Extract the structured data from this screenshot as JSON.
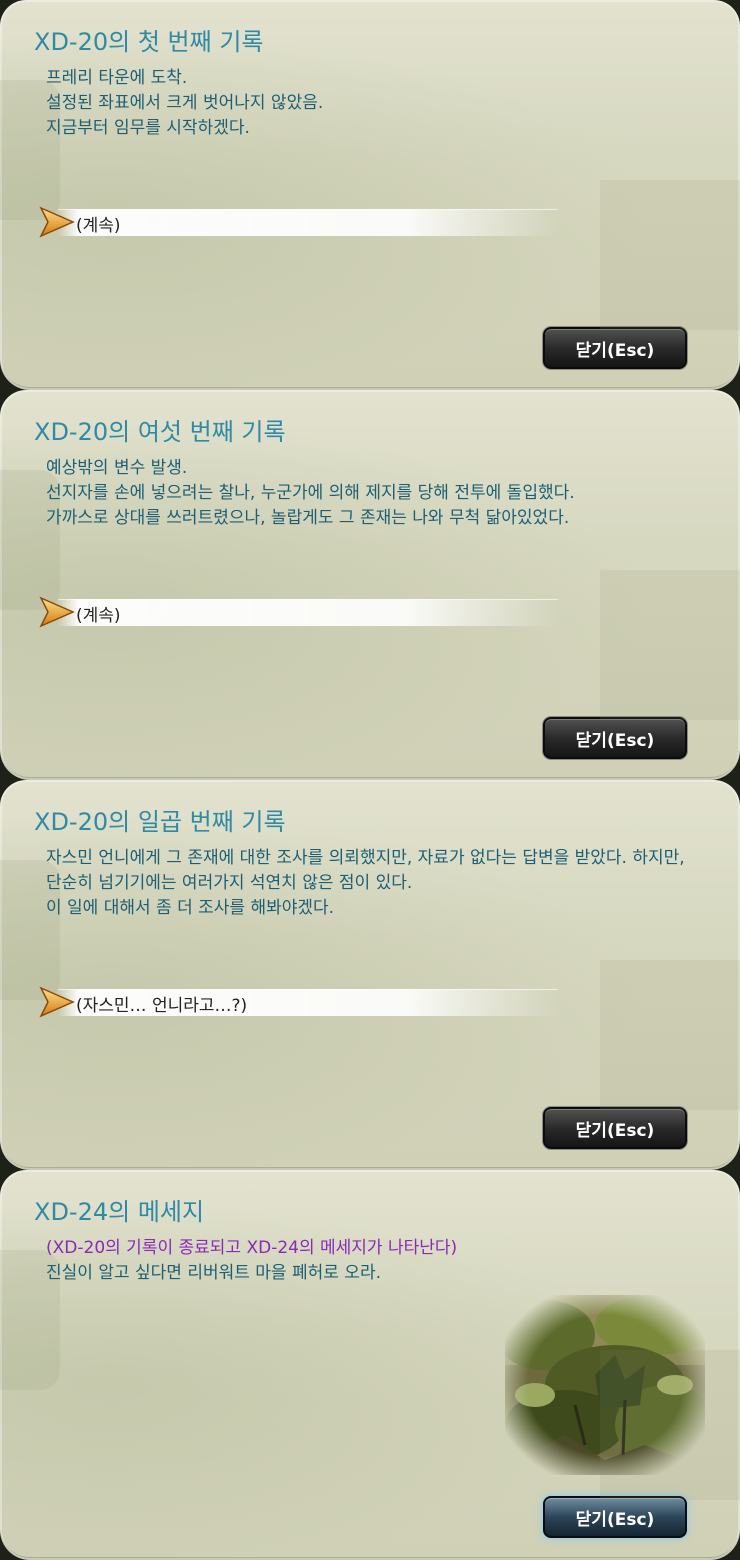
{
  "panels": [
    {
      "title": "XD-20의 첫 번째 기록",
      "lines": [
        "프레리 타운에 도착.",
        "설정된 좌표에서 크게 벗어나지 않았음.",
        "지금부터 임무를 시작하겠다."
      ],
      "choice": "(계속)",
      "close_label": "닫기(Esc)"
    },
    {
      "title": "XD-20의 여섯 번째 기록",
      "lines": [
        "예상밖의 변수 발생.",
        "선지자를 손에 넣으려는 찰나, 누군가에 의해 제지를 당해 전투에 돌입했다.",
        "가까스로 상대를 쓰러트렸으나, 놀랍게도 그 존재는 나와 무척 닮아있었다."
      ],
      "choice": "(계속)",
      "close_label": "닫기(Esc)"
    },
    {
      "title": "XD-20의 일곱 번째 기록",
      "lines": [
        "자스민 언니에게 그 존재에 대한 조사를 의뢰했지만, 자료가 없다는 답변을 받았다. 하지만, 단순히 넘기기에는 여러가지 석연치 않은 점이 있다.",
        "이 일에 대해서 좀 더 조사를 해봐야겠다."
      ],
      "choice": "(자스민… 언니라고…?)",
      "close_label": "닫기(Esc)"
    },
    {
      "title": "XD-24의 메세지",
      "lines": [
        "(XD-20의 기록이 종료되고 XD-24의 메세지가 나타난다)",
        "진실이 알고 싶다면 리버워트 마을 폐허로 오라."
      ],
      "close_label": "닫기(Esc)"
    }
  ],
  "colors": {
    "title": "#2f8aa6",
    "body": "#1c5f75",
    "system_note": "#8a2ab8"
  },
  "icons": {
    "choice_marker": "arrow-right-icon"
  }
}
